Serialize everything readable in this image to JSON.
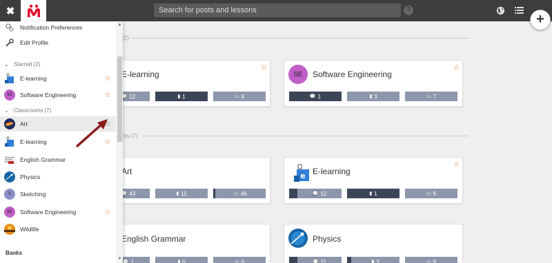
{
  "topbar": {
    "close_symbol": "✖",
    "search_placeholder": "Search for posts and lessons",
    "help_symbol": "?",
    "plus_symbol": "+",
    "logo_color": "#e0112b"
  },
  "sidebar": {
    "menu": [
      {
        "label": "Notification Preferences",
        "icon": "gears-icon"
      },
      {
        "label": "Edit Profile",
        "icon": "wrench-icon"
      }
    ],
    "starred_header": "Starred (2)",
    "starred": [
      {
        "label": "E-learning",
        "icon": "elearning-icon",
        "star": "☆"
      },
      {
        "label": "Software Engineering",
        "icon": "se-avatar",
        "avatar_text": "SE",
        "star": "☆"
      }
    ],
    "classrooms_header": "Classrooms (7)",
    "classrooms": [
      {
        "label": "Art",
        "star": "☆",
        "icon": "art-thumbnail"
      },
      {
        "label": "E-learning",
        "star": "☆",
        "icon": "elearning-icon"
      },
      {
        "label": "English Grammar",
        "star": "",
        "icon": "grammar-thumbnail"
      },
      {
        "label": "Physics",
        "star": "",
        "icon": "physics-thumbnail"
      },
      {
        "label": "Sketching",
        "star": "",
        "icon": "sketching-avatar",
        "avatar_text": "S"
      },
      {
        "label": "Software Engineering",
        "star": "☆",
        "icon": "se-avatar",
        "avatar_text": "SE"
      },
      {
        "label": "Wildlife",
        "star": "",
        "icon": "wildlife-thumbnail"
      }
    ],
    "banks_header": "Banks"
  },
  "main": {
    "starred_section_fragment": "(2)",
    "classrooms_section_fragment": "ms (7)",
    "cards": [
      {
        "title": "E-learning",
        "star": "☆",
        "stats": [
          "12",
          "1",
          "6"
        ]
      },
      {
        "title": "Software Engineering",
        "avatar_text": "SE",
        "star": "☆",
        "stats": [
          "1",
          "3",
          "7"
        ]
      },
      {
        "title": "Art",
        "star": "",
        "stats": [
          "43",
          "11",
          "46"
        ]
      },
      {
        "title": "E-learning",
        "star": "☆",
        "stats": [
          "12",
          "1",
          "6"
        ]
      },
      {
        "title": "English Grammar",
        "star": "",
        "stats": [
          "1",
          "0",
          "0"
        ]
      },
      {
        "title": "Physics",
        "star": "",
        "stats": [
          "11",
          "3",
          "9"
        ]
      }
    ]
  },
  "colors": {
    "topbar": "#3d3d3d",
    "stat_light": "#8d97ab",
    "stat_dark": "#3c4558",
    "star": "#d2691e",
    "arrow": "#8b1a1a",
    "se_avatar": "#c05fc8",
    "sketching_avatar": "#8a8fc7"
  }
}
